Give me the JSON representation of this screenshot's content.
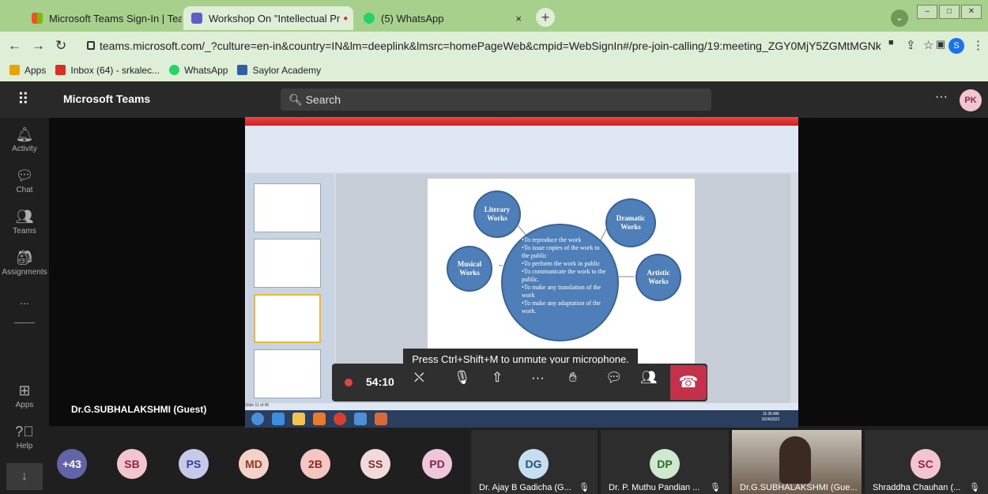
{
  "browser": {
    "tabs": [
      {
        "title": "Microsoft Teams Sign-In | Teams",
        "close": "×",
        "favicon_color": "#f25022"
      },
      {
        "title": "Workshop On \"Intellectual Pr",
        "close": "×",
        "favicon_color": "#5b5fc7"
      },
      {
        "title": "(5) WhatsApp",
        "close": "×",
        "favicon_color": "#25d366"
      }
    ],
    "new_tab": "+",
    "url": "teams.microsoft.com/_?culture=en-in&country=IN&lm=deeplink&lmsrc=homePageWeb&cmpid=WebSignIn#/pre-join-calling/19:meeting_ZGY0MjY5ZGMtMGNk...",
    "bookmarks": [
      {
        "label": "Apps",
        "color": "#e8a400"
      },
      {
        "label": "Inbox (64) - srkalec...",
        "color": "#d93025"
      },
      {
        "label": "WhatsApp",
        "color": "#25d366"
      },
      {
        "label": "Saylor Academy",
        "color": "#2f5fa8"
      }
    ],
    "profile_initial": "S"
  },
  "teams": {
    "app_name": "Microsoft Teams",
    "search_placeholder": "Search",
    "user_initials": "PK",
    "rail": [
      {
        "label": "Activity",
        "icon": "bell-icon"
      },
      {
        "label": "Chat",
        "icon": "chat-icon"
      },
      {
        "label": "Teams",
        "icon": "teams-icon"
      },
      {
        "label": "Assignments",
        "icon": "assignments-icon"
      },
      {
        "label": "Apps",
        "icon": "apps-icon"
      },
      {
        "label": "Help",
        "icon": "help-icon"
      }
    ],
    "rail_more": "...",
    "presenter": "Dr.G.SUBHALAKSHMI (Guest)",
    "toast": "Press Ctrl+Shift+M to unmute your microphone.",
    "timer": "54:10"
  },
  "slide": {
    "nodes": [
      {
        "label": "Literary Works"
      },
      {
        "label": "Dramatic Works"
      },
      {
        "label": "Musical Works"
      },
      {
        "label": "Artistic Works"
      }
    ],
    "center_lines": [
      "•To reproduce the work",
      "•To issue copies of the work to the public",
      "•To perform the work in public",
      "•To communicate the work to the public.",
      "•To make any translation of the work",
      "•To make any adaptation of the work."
    ],
    "status": "Slide 11 of 46",
    "clock": "11:30 AM",
    "date": "5/24/2022"
  },
  "gallery": {
    "avatars": [
      {
        "initials": "+43",
        "bg": "#6264a7",
        "fg": "#ffffff"
      },
      {
        "initials": "SB",
        "bg": "#f3c5cf",
        "fg": "#8a2a3e"
      },
      {
        "initials": "PS",
        "bg": "#c7c9ea",
        "fg": "#3a3d8f"
      },
      {
        "initials": "MD",
        "bg": "#f4d2c8",
        "fg": "#8a3a22"
      },
      {
        "initials": "2B",
        "bg": "#f6c7c2",
        "fg": "#8a2a22"
      },
      {
        "initials": "SS",
        "bg": "#f3dada",
        "fg": "#7a3030"
      },
      {
        "initials": "PD",
        "bg": "#f0c7da",
        "fg": "#7a2a50"
      }
    ],
    "tiles": [
      {
        "initials": "DG",
        "name": "Dr. Ajay B Gadicha (G...",
        "bg": "#c7ddf0",
        "fg": "#22527a"
      },
      {
        "initials": "DP",
        "name": "Dr. P. Muthu Pandian ...",
        "bg": "#cfe9cf",
        "fg": "#2a6a2a"
      },
      {
        "initials": "",
        "name": "Dr.G.SUBHALAKSHMI (Gue...",
        "bg": "#7a6a5a",
        "fg": "#ffffff"
      },
      {
        "initials": "SC",
        "name": "Shraddha Chauhan (...",
        "bg": "#f3c5cf",
        "fg": "#8a2a3e"
      }
    ]
  }
}
